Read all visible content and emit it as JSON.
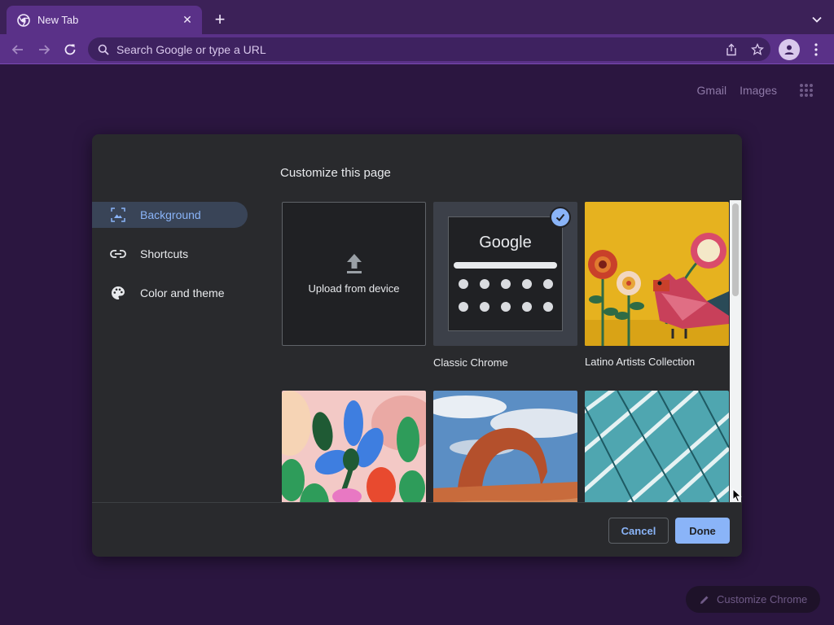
{
  "browser": {
    "tab": {
      "title": "New Tab",
      "close_label": "✕"
    },
    "new_tab_label": "+",
    "omnibox": {
      "placeholder": "Search Google or type a URL"
    }
  },
  "ntp": {
    "links": {
      "gmail": "Gmail",
      "images": "Images"
    },
    "customize_chrome": "Customize Chrome"
  },
  "dialog": {
    "title": "Customize this page",
    "sidebar": {
      "items": [
        {
          "label": "Background",
          "icon": "image-icon",
          "active": true
        },
        {
          "label": "Shortcuts",
          "icon": "link-icon",
          "active": false
        },
        {
          "label": "Color and theme",
          "icon": "palette-icon",
          "active": false
        }
      ]
    },
    "tiles": {
      "upload": "Upload from device",
      "classic": {
        "label": "Classic Chrome",
        "logo": "Google",
        "selected": true
      },
      "latino": "Latino Artists Collection"
    },
    "buttons": {
      "cancel": "Cancel",
      "done": "Done"
    }
  },
  "colors": {
    "accent": "#8ab4f8",
    "toolbar": "#5a3188",
    "dialog_bg": "#292a2d"
  }
}
